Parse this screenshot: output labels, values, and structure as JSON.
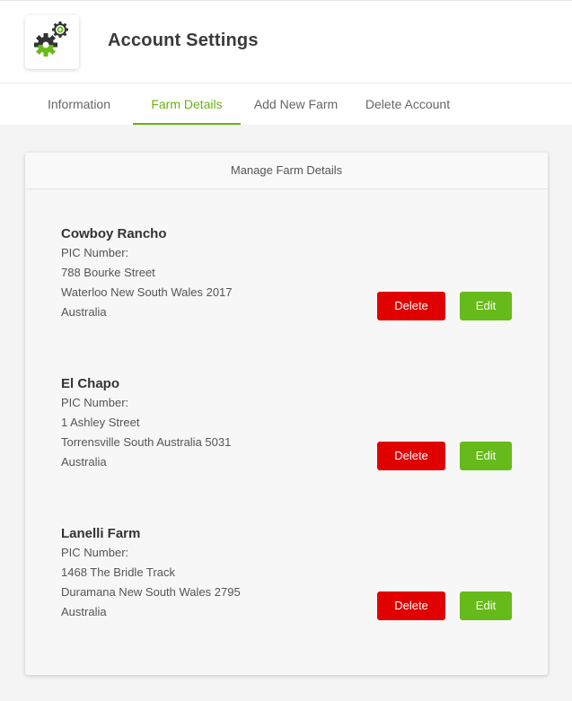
{
  "header": {
    "title": "Account Settings",
    "logo_icon": "gears-icon",
    "logo_colors": [
      "#333333",
      "#66bb1a"
    ]
  },
  "tabs": [
    {
      "label": "Information",
      "active": false
    },
    {
      "label": "Farm Details",
      "active": true
    },
    {
      "label": "Add New Farm",
      "active": false
    },
    {
      "label": "Delete Account",
      "active": false
    }
  ],
  "card": {
    "title": "Manage Farm Details"
  },
  "farms": [
    {
      "name": "Cowboy Rancho",
      "pic_label": "PIC Number:",
      "street": "788 Bourke Street",
      "locality": "Waterloo New South Wales 2017",
      "country": "Australia"
    },
    {
      "name": "El Chapo",
      "pic_label": "PIC Number:",
      "street": "1 Ashley Street",
      "locality": "Torrensville South Australia 5031",
      "country": "Australia"
    },
    {
      "name": "Lanelli Farm",
      "pic_label": "PIC Number:",
      "street": "1468 The Bridle Track",
      "locality": "Duramana New South Wales 2795",
      "country": "Australia"
    }
  ],
  "actions": {
    "delete_label": "Delete",
    "edit_label": "Edit"
  },
  "colors": {
    "accent": "#6ab312",
    "delete": "#e00000",
    "edit": "#66bb1a"
  }
}
